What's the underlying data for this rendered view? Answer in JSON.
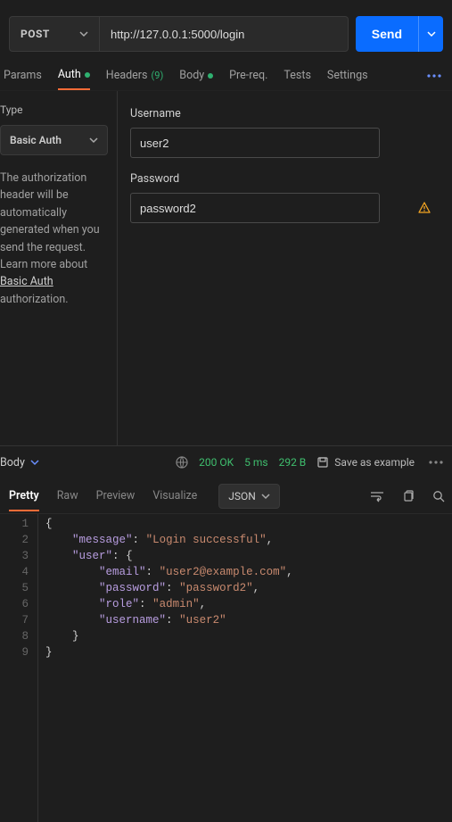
{
  "request": {
    "method": "POST",
    "url": "http://127.0.0.1:5000/login",
    "send_label": "Send"
  },
  "tabs": {
    "params": "Params",
    "auth": "Auth",
    "headers": "Headers",
    "headers_count": "(9)",
    "body": "Body",
    "prereq": "Pre-req.",
    "tests": "Tests",
    "settings": "Settings"
  },
  "auth": {
    "type_label": "Type",
    "type_value": "Basic Auth",
    "help_pre": "The authorization header will be automatically generated when you send the request. Learn more about ",
    "help_link": "Basic Auth",
    "help_post": " authorization.",
    "username_label": "Username",
    "username_value": "user2",
    "password_label": "Password",
    "password_value": "password2"
  },
  "response": {
    "body_label": "Body",
    "status": "200 OK",
    "time": "5 ms",
    "size": "292 B",
    "save_example": "Save as example"
  },
  "view_tabs": {
    "pretty": "Pretty",
    "raw": "Raw",
    "preview": "Preview",
    "visualize": "Visualize",
    "format": "JSON"
  },
  "body_json": {
    "message": "Login successful",
    "user": {
      "email": "user2@example.com",
      "password": "password2",
      "role": "admin",
      "username": "user2"
    }
  }
}
